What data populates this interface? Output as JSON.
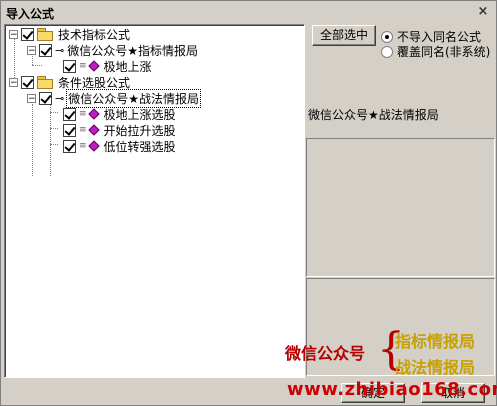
{
  "window": {
    "title": "导入公式",
    "close_glyph": "×"
  },
  "tree": {
    "group1": {
      "label": "技术指标公式",
      "expander": "−"
    },
    "group1_sub": {
      "label": "微信公众号★指标情报局",
      "expander": "−"
    },
    "group1_items": [
      "极地上涨"
    ],
    "group2": {
      "label": "条件选股公式",
      "expander": "−"
    },
    "group2_sub": {
      "label": "微信公众号★战法情报局",
      "expander": "−"
    },
    "group2_items": [
      "极地上涨选股",
      "开始拉升选股",
      "低位转强选股"
    ]
  },
  "buttons": {
    "select_all": "全部选中",
    "ok": "确定",
    "cancel": "取消"
  },
  "options": {
    "no_import": "不导入同名公式",
    "overwrite": "覆盖同名(非系统)"
  },
  "detail": {
    "name": "微信公众号★战法情报局"
  },
  "watermark": {
    "left": "微信公众号",
    "right1": "指标情报局",
    "right2": "战法情报局",
    "url": "www.zhibiao168.com"
  },
  "colors": {
    "window_bg": "#d4d0c8",
    "watermark_red": "#b80000",
    "watermark_gold": "#c8a000",
    "item_icon": "#c020c0"
  }
}
